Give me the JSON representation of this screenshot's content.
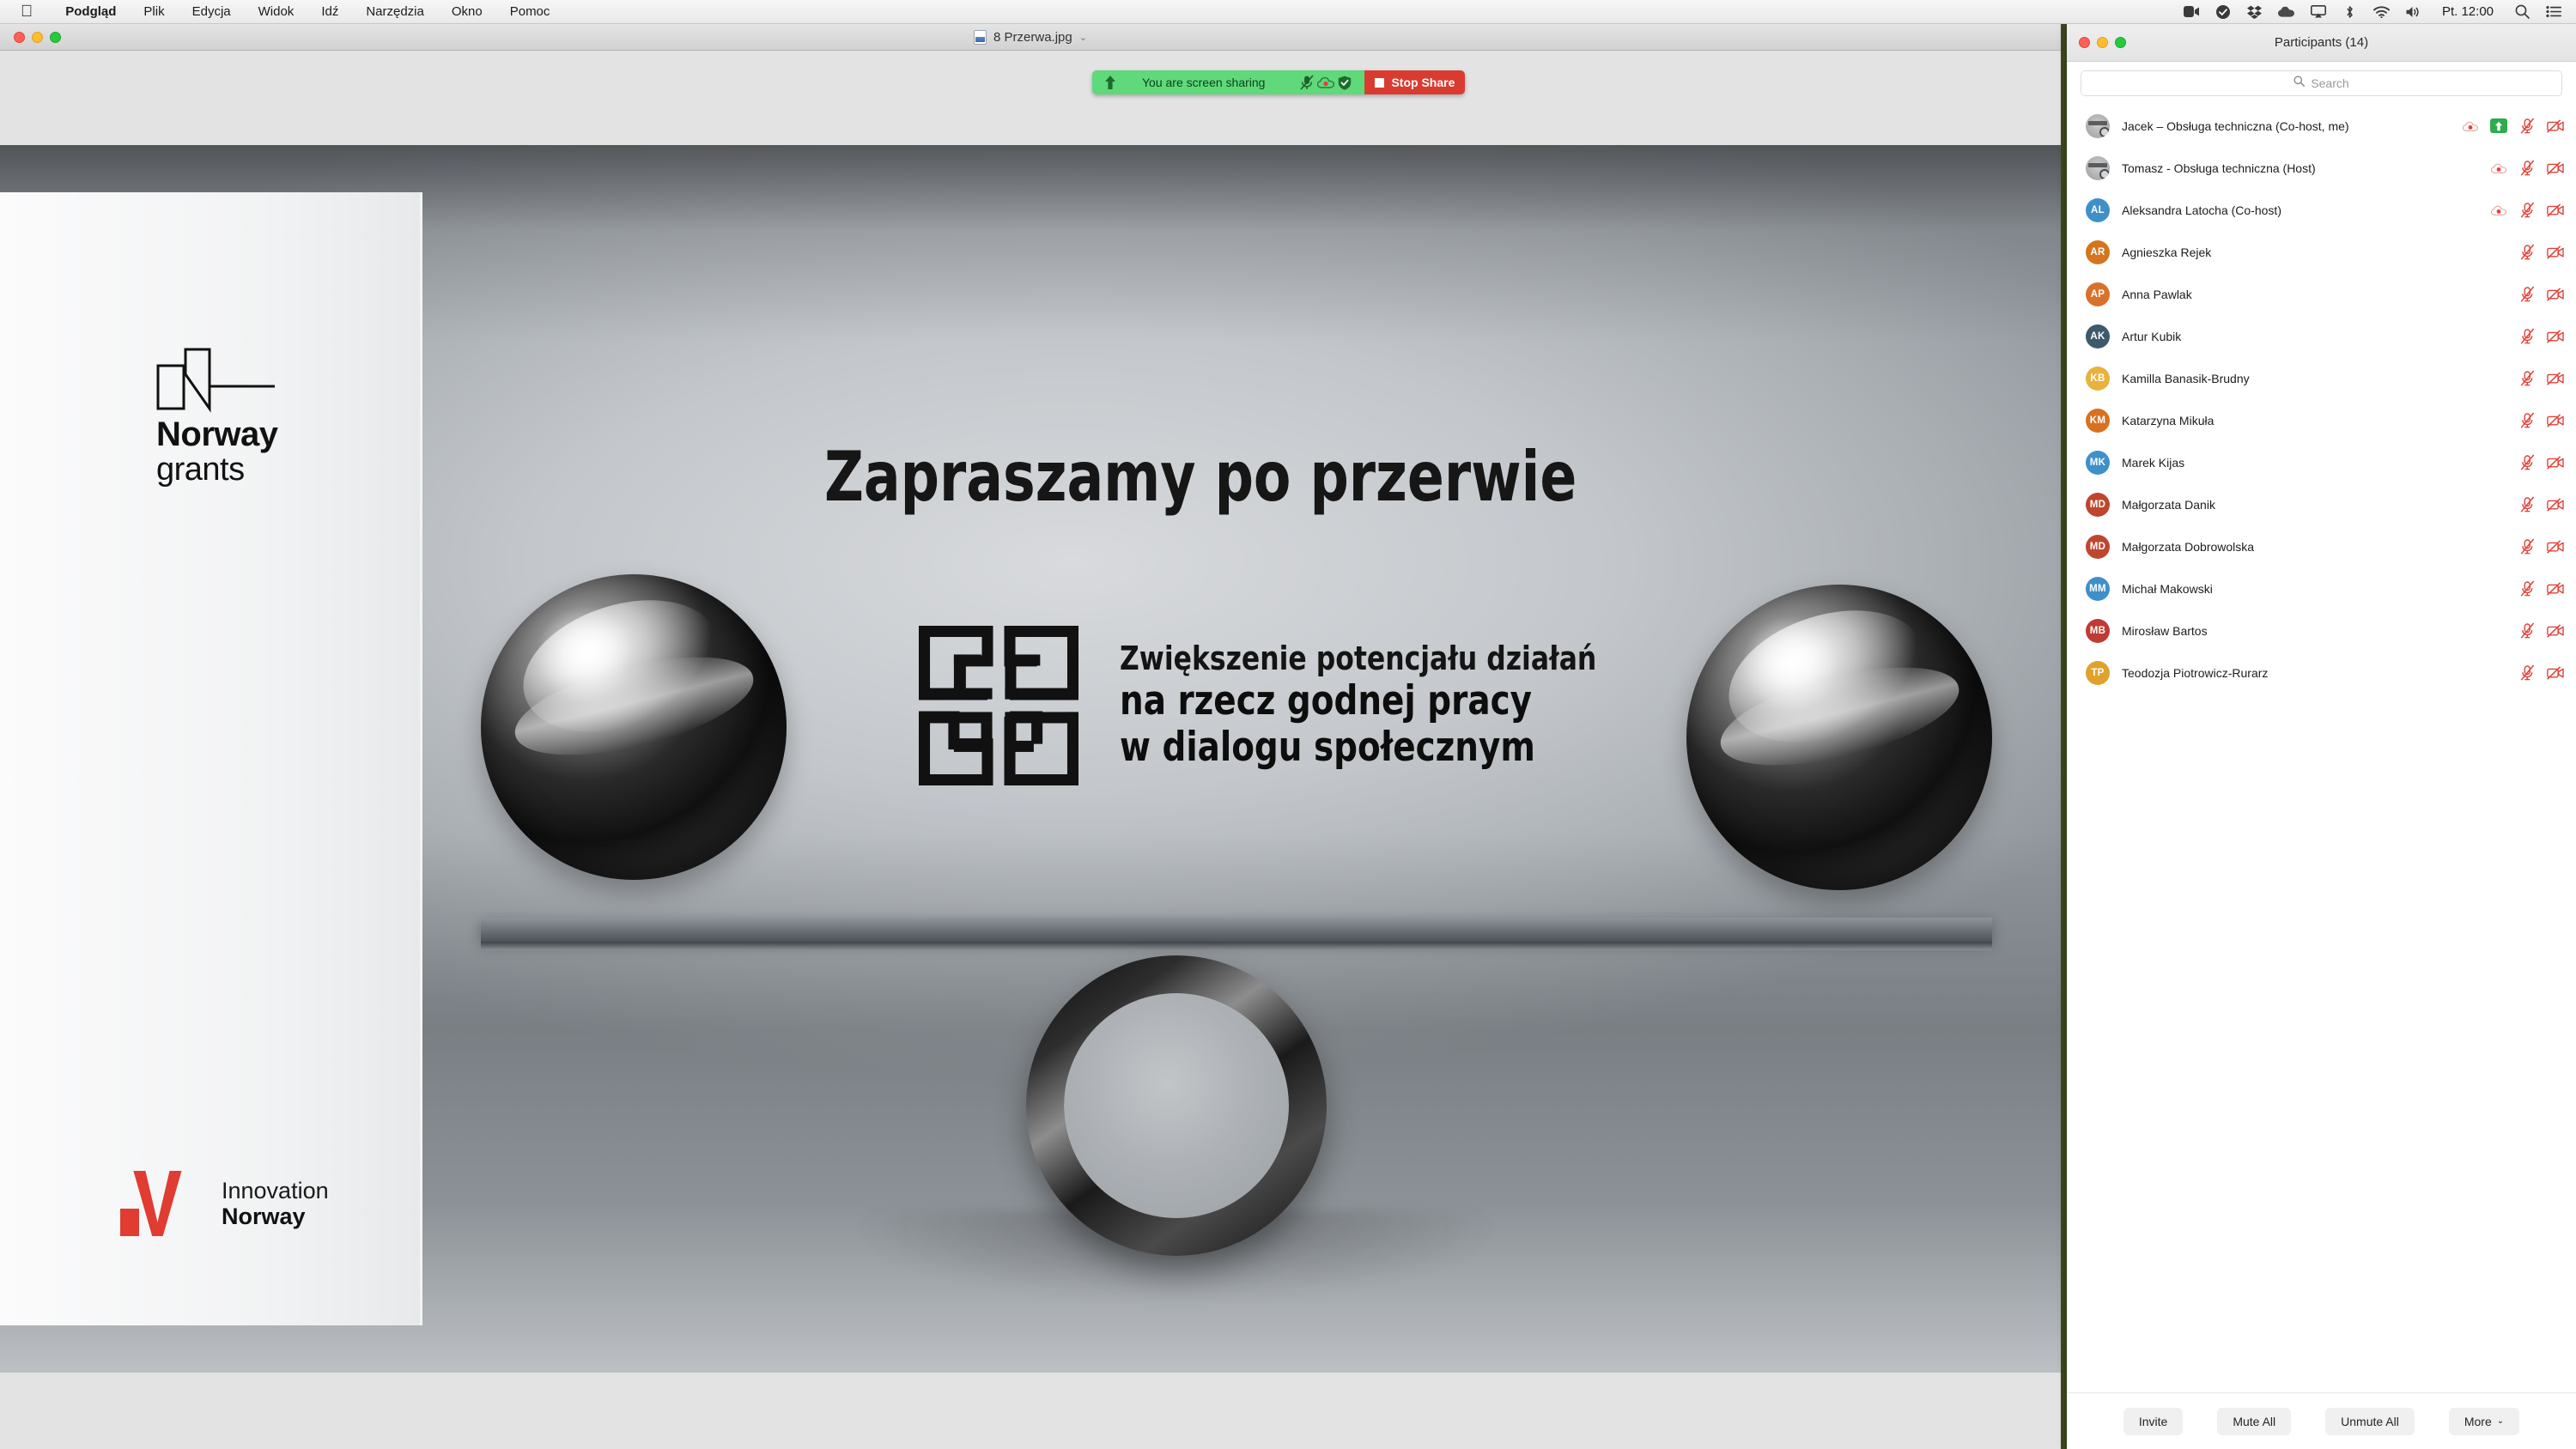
{
  "menubar": {
    "apple_icon": "apple-icon",
    "items": [
      {
        "label": "Podgląd",
        "bold": true
      },
      {
        "label": "Plik",
        "bold": false
      },
      {
        "label": "Edycja",
        "bold": false
      },
      {
        "label": "Widok",
        "bold": false
      },
      {
        "label": "Idź",
        "bold": false
      },
      {
        "label": "Narzędzia",
        "bold": false
      },
      {
        "label": "Okno",
        "bold": false
      },
      {
        "label": "Pomoc",
        "bold": false
      }
    ],
    "status_icons": [
      "zoom-video-icon",
      "checkmark-circle-icon",
      "dropbox-icon",
      "onedrive-cloud-icon",
      "airplay-icon",
      "bluetooth-icon",
      "wifi-icon",
      "volume-icon"
    ],
    "clock": "Pt. 12:00",
    "trailing_icons": [
      "search-icon",
      "control-center-icon"
    ]
  },
  "preview_window": {
    "title": "8 Przerwa.jpg",
    "traffic_lights": [
      "close-button",
      "minimize-button",
      "zoom-button"
    ]
  },
  "share_bar": {
    "share_icon": "screen-share-arrow-icon",
    "message": "You are screen sharing",
    "icons": [
      "mic-muted-icon",
      "cloud-record-icon",
      "shield-icon"
    ],
    "stop_label": "Stop Share",
    "green": "#5fd97a",
    "red": "#d93b31"
  },
  "slide": {
    "headline": "Zapraszamy po przerwie",
    "project": {
      "logo": "four-squares-maze-logo",
      "line1": "Zwiększenie potencjału działań",
      "line2": "na rzecz godnej pracy",
      "line3": "w dialogu społecznym"
    },
    "norway_grants": {
      "logo": "norway-grants-mark",
      "line1": "Norway",
      "line2": "grants"
    },
    "innovation_norway": {
      "logo": "innovation-norway-mark",
      "line1": "Innovation",
      "line2": "Norway"
    }
  },
  "participants_panel": {
    "title": "Participants (14)",
    "traffic_lights": [
      "close-button",
      "minimize-button",
      "zoom-button"
    ],
    "search_placeholder": "Search",
    "search_value": "",
    "rows": [
      {
        "name": "Jacek – Obsługa techniczna (Co-host, me)",
        "initials": "",
        "avatar_type": "photo",
        "color": "#b0b0b0",
        "icons": [
          "record-icon",
          "share-badge-icon",
          "mic-muted-icon",
          "video-off-icon"
        ]
      },
      {
        "name": "Tomasz - Obsługa techniczna (Host)",
        "initials": "",
        "avatar_type": "photo",
        "color": "#b0b0b0",
        "icons": [
          "record-icon",
          "mic-muted-icon",
          "video-off-icon"
        ]
      },
      {
        "name": "Aleksandra Latocha (Co-host)",
        "initials": "AL",
        "avatar_type": "initials",
        "color": "#3f90c8",
        "icons": [
          "record-icon",
          "mic-muted-icon",
          "video-off-icon"
        ]
      },
      {
        "name": "Agnieszka Rejek",
        "initials": "AR",
        "avatar_type": "initials",
        "color": "#d4751e",
        "icons": [
          "mic-muted-icon",
          "video-off-icon"
        ]
      },
      {
        "name": "Anna Pawlak",
        "initials": "AP",
        "avatar_type": "initials",
        "color": "#d9712a",
        "icons": [
          "mic-muted-icon",
          "video-off-icon"
        ]
      },
      {
        "name": "Artur Kubik",
        "initials": "AK",
        "avatar_type": "initials",
        "color": "#3d5a6c",
        "icons": [
          "mic-muted-icon",
          "video-off-icon"
        ]
      },
      {
        "name": "Kamilla Banasik-Brudny",
        "initials": "KB",
        "avatar_type": "initials",
        "color": "#e8b33c",
        "icons": [
          "mic-muted-icon",
          "video-off-icon"
        ]
      },
      {
        "name": "Katarzyna Mikuła",
        "initials": "KM",
        "avatar_type": "initials",
        "color": "#d9711f",
        "icons": [
          "mic-muted-icon",
          "video-off-icon"
        ]
      },
      {
        "name": "Marek Kijas",
        "initials": "MK",
        "avatar_type": "initials",
        "color": "#3f90c8",
        "icons": [
          "mic-muted-icon",
          "video-off-icon"
        ]
      },
      {
        "name": "Małgorzata Danik",
        "initials": "MD",
        "avatar_type": "initials",
        "color": "#c0452e",
        "icons": [
          "mic-muted-icon",
          "video-off-icon"
        ]
      },
      {
        "name": "Małgorzata Dobrowolska",
        "initials": "MD",
        "avatar_type": "initials",
        "color": "#c0452e",
        "icons": [
          "mic-muted-icon",
          "video-off-icon"
        ]
      },
      {
        "name": "Michał Makowski",
        "initials": "MM",
        "avatar_type": "initials",
        "color": "#3f90c8",
        "icons": [
          "mic-muted-icon",
          "video-off-icon"
        ]
      },
      {
        "name": "Mirosław Bartos",
        "initials": "MB",
        "avatar_type": "initials",
        "color": "#bf3b33",
        "icons": [
          "mic-muted-icon",
          "video-off-icon"
        ]
      },
      {
        "name": "Teodozja Piotrowicz-Rurarz",
        "initials": "TP",
        "avatar_type": "initials",
        "color": "#e0a22c",
        "icons": [
          "mic-muted-icon",
          "video-off-icon"
        ]
      }
    ],
    "footer_buttons": [
      {
        "label": "Invite",
        "has_chevron": false
      },
      {
        "label": "Mute All",
        "has_chevron": false
      },
      {
        "label": "Unmute All",
        "has_chevron": false
      },
      {
        "label": "More",
        "has_chevron": true
      }
    ],
    "chevron": "⌄"
  }
}
